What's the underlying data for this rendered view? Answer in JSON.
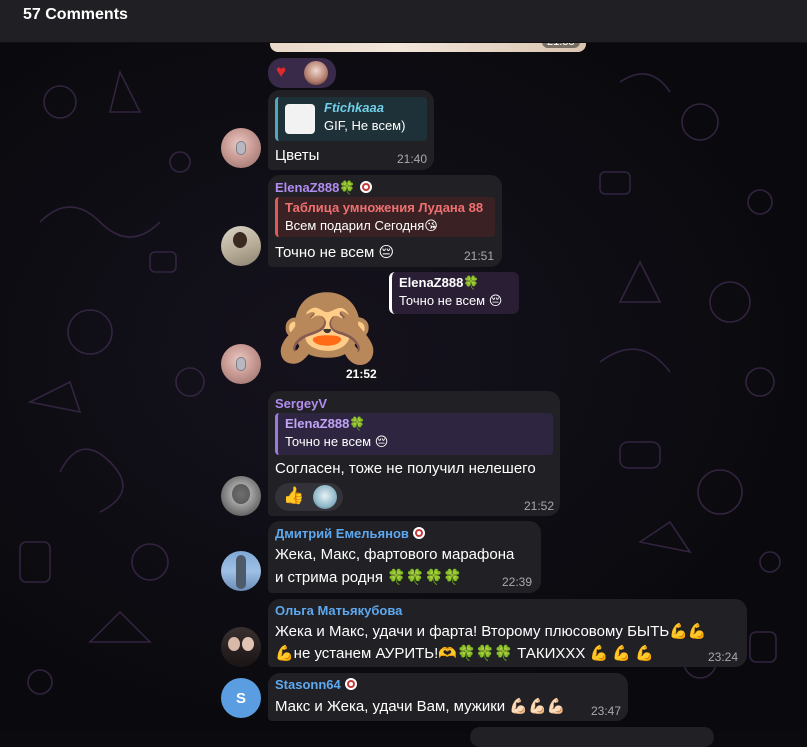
{
  "header": {
    "title": "57 Comments"
  },
  "messages": {
    "gif_time": "21:38",
    "m1": {
      "reply_name": "Ftichkaaa",
      "reply_text": "GIF, Не всем)",
      "text": "Цветы",
      "time": "21:40"
    },
    "m2": {
      "author": "ElenaZ888🍀",
      "reply_name": "Таблица умножения Лудана 88",
      "reply_text": "Всем подарил Сегодня😘",
      "text": "Точно не всем 😔",
      "time": "21:51"
    },
    "m3": {
      "reply_name": "ElenaZ888🍀",
      "reply_text": "Точно не всем 😔",
      "sticker": "🙈",
      "time": "21:52"
    },
    "m4": {
      "author": "SergeyV",
      "reply_name": "ElenaZ888🍀",
      "reply_text": "Точно не всем 😔",
      "text": "Согласен, тоже не получил нелешего",
      "reaction": "👍",
      "time": "21:52"
    },
    "m5": {
      "author": "Дмитрий Емельянов",
      "line1": "Жека, Макс, фартового марафона",
      "line2": "и стрима родня 🍀🍀🍀🍀",
      "time": "22:39"
    },
    "m6": {
      "author": "Ольга Матьякубова",
      "line1": "Жека и Макс, удачи и фарта! Второму плюсовому БЫТЬ💪💪",
      "line2": "💪не устанем АУРИТЬ!🫶🍀🍀🍀 ТАКИХХХ 💪 💪 💪",
      "time": "23:24"
    },
    "m7": {
      "author": "Stasonn64",
      "avatar_letter": "S",
      "text": "Макс и Жека, удачи Вам, мужики 💪🏻💪🏻💪🏻",
      "time": "23:47"
    }
  },
  "colors": {
    "bubble": "#212125",
    "author_purple": "#b18cf0",
    "author_blue": "#5ea8f0",
    "reply_red": "#e05a5a",
    "reply_teal": "#4fa8c0",
    "reply_purple": "#9b7ae0"
  }
}
